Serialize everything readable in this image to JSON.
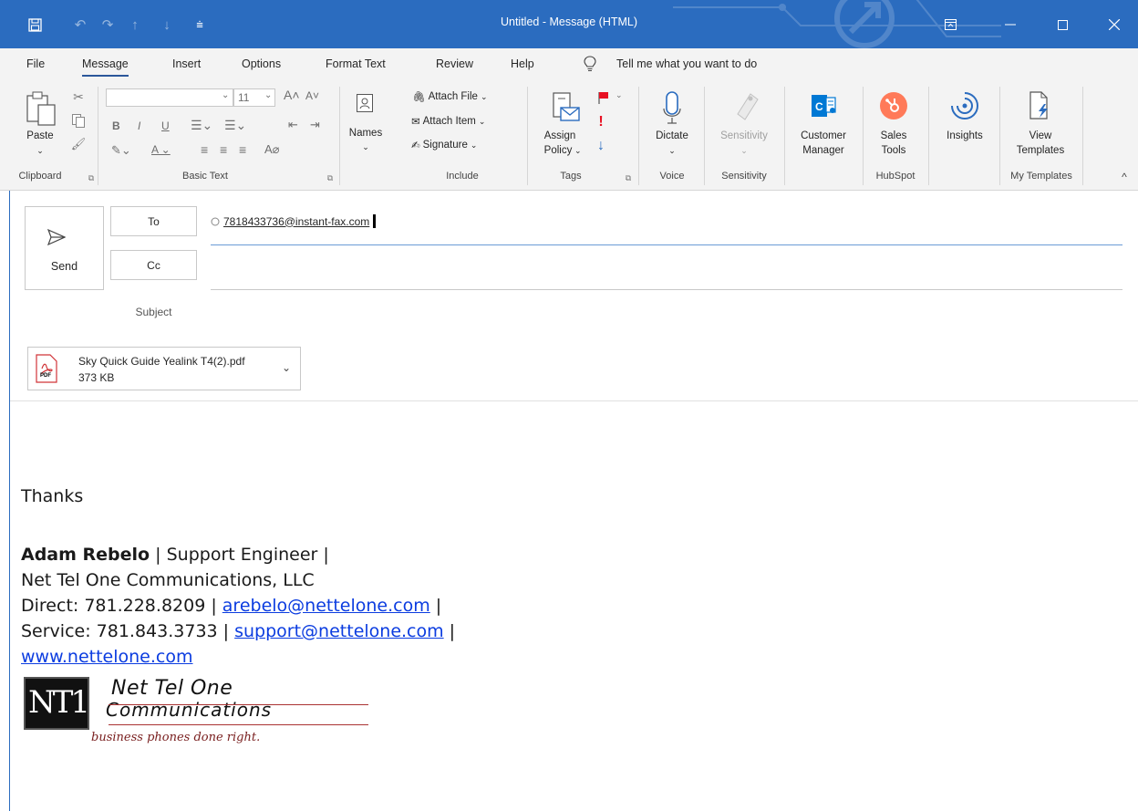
{
  "window": {
    "title": "Untitled  -  Message (HTML)"
  },
  "tabs": [
    "File",
    "Message",
    "Insert",
    "Options",
    "Format Text",
    "Review",
    "Help"
  ],
  "tell_me": "Tell me what you want to do",
  "ribbon": {
    "clipboard": {
      "paste": "Paste",
      "group": "Clipboard"
    },
    "basic_text": {
      "font_size": "11",
      "group": "Basic Text"
    },
    "names": {
      "label": "Names"
    },
    "include": {
      "attach_file": "Attach File",
      "attach_item": "Attach Item",
      "signature": "Signature",
      "group": "Include"
    },
    "tags": {
      "assign_policy_1": "Assign",
      "assign_policy_2": "Policy",
      "group": "Tags"
    },
    "voice": {
      "dictate": "Dictate",
      "group": "Voice"
    },
    "sensitivity": {
      "button": "Sensitivity",
      "group": "Sensitivity"
    },
    "customer_manager": {
      "line1": "Customer",
      "line2": "Manager"
    },
    "hubspot": {
      "line1": "Sales",
      "line2": "Tools",
      "group": "HubSpot"
    },
    "insights": {
      "label": "Insights"
    },
    "templates": {
      "line1": "View",
      "line2": "Templates",
      "group": "My Templates"
    }
  },
  "compose": {
    "send": "Send",
    "to_label": "To",
    "cc_label": "Cc",
    "subject_label": "Subject",
    "to_value": "7818433736@instant-fax.com"
  },
  "attachment": {
    "name": "Sky Quick Guide Yealink T4(2).pdf",
    "size": "373 KB",
    "type_badge": "PDF"
  },
  "body": {
    "thanks": "Thanks",
    "sig_name": "Adam Rebelo",
    "sig_title": " | Support Engineer |",
    "sig_company": "Net Tel One Communications, LLC",
    "direct_label": "Direct: 781.228.8209 | ",
    "direct_email": "arebelo@nettelone.com",
    "direct_tail": " |",
    "service_label": "Service: 781.843.3733 | ",
    "service_email": "support@nettelone.com",
    "service_tail": " |",
    "website": "www.nettelone.com",
    "logo_line1": "Net Tel One",
    "logo_line2": "Communications",
    "logo_tagline": "business phones done right.",
    "logo_letters": "NT1"
  },
  "colors": {
    "titlebar": "#2b6cbf",
    "ribbon_bg": "#f3f3f3",
    "link": "#0b3ce0",
    "flag_red": "#e81123",
    "hubspot": "#ff7a59",
    "customer_manager": "#0078d4"
  }
}
